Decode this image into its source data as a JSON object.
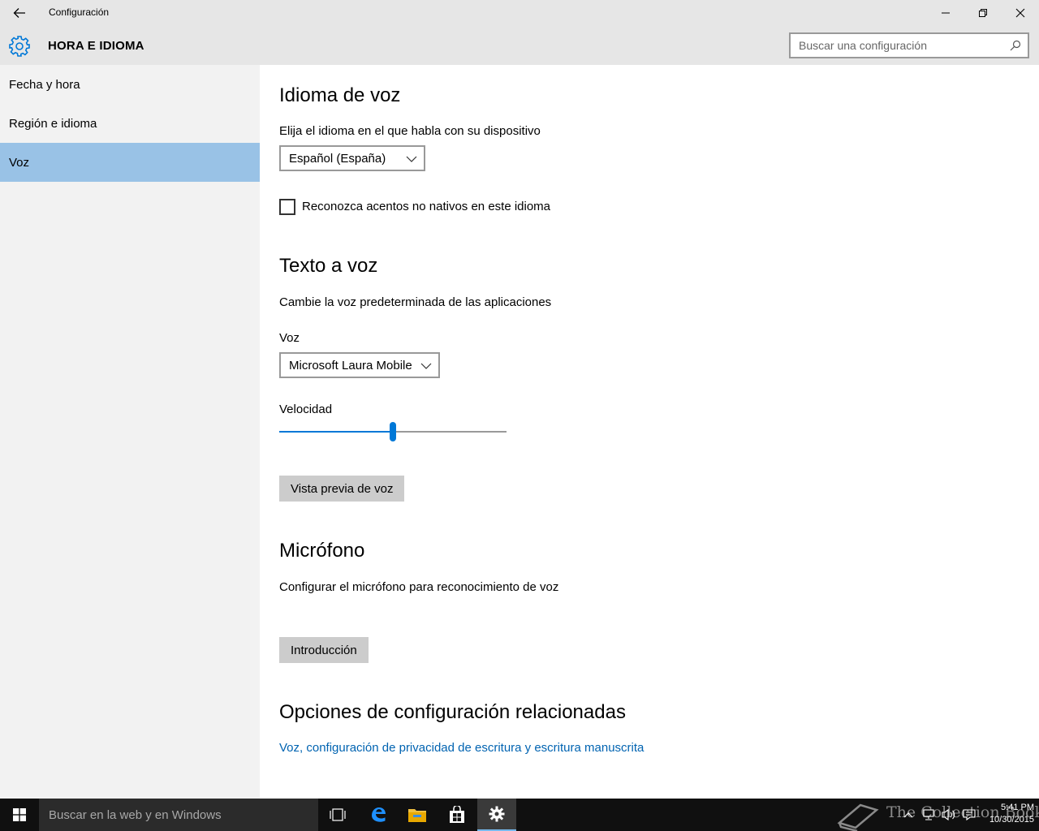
{
  "window": {
    "title": "Configuración",
    "section_title": "HORA E IDIOMA",
    "search_placeholder": "Buscar una configuración"
  },
  "sidebar": {
    "items": [
      {
        "label": "Fecha y hora",
        "active": false
      },
      {
        "label": "Región e idioma",
        "active": false
      },
      {
        "label": "Voz",
        "active": true
      }
    ]
  },
  "speech_language": {
    "heading": "Idioma de voz",
    "description": "Elija el idioma en el que habla con su dispositivo",
    "selected_language": "Español (España)",
    "accents_checkbox_label": "Reconozca acentos no nativos en este idioma",
    "accents_checked": false
  },
  "text_to_speech": {
    "heading": "Texto a voz",
    "description": "Cambie la voz predeterminada de las aplicaciones",
    "voice_label": "Voz",
    "selected_voice": "Microsoft Laura Mobile",
    "speed_label": "Velocidad",
    "speed_fraction": 0.5,
    "preview_button": "Vista previa de voz"
  },
  "microphone": {
    "heading": "Micrófono",
    "description": "Configurar el micrófono para reconocimiento de voz",
    "start_button": "Introducción"
  },
  "related": {
    "heading": "Opciones de configuración relacionadas",
    "link": "Voz, configuración de privacidad de escritura y escritura manuscrita"
  },
  "taskbar": {
    "search_placeholder": "Buscar en la web y en Windows",
    "watermark": "The Collection Book",
    "time": "5:41 PM",
    "date": "10/30/2015"
  },
  "colors": {
    "accent": "#0078d7",
    "sidebar_active": "#99c2e6",
    "link": "#0063b1"
  }
}
